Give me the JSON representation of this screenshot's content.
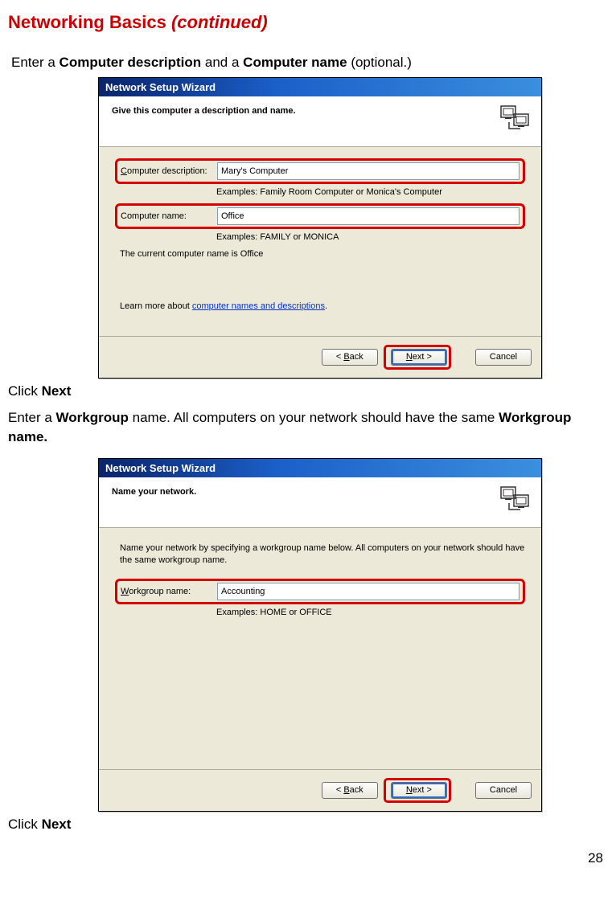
{
  "page": {
    "title_main": "Networking Basics ",
    "title_cont": "(continued)",
    "page_number": "28"
  },
  "instr": {
    "i1_pre": "Enter a ",
    "i1_b1": "Computer description",
    "i1_mid": " and a ",
    "i1_b2": "Computer name",
    "i1_post": " (optional.)",
    "click": "Click ",
    "next": "Next",
    "i2_pre": "Enter a ",
    "i2_b1": "Workgroup",
    "i2_mid": " name.  All computers on your network should have the same ",
    "i2_b2": "Workgroup name."
  },
  "wiz1": {
    "title": "Network Setup Wizard",
    "heading": "Give this computer a description and name.",
    "desc_label_u": "C",
    "desc_label_rest": "omputer description:",
    "desc_value": "Mary's Computer",
    "desc_example": "Examples: Family Room Computer or Monica's Computer",
    "name_label": "Computer name:",
    "name_value": "Office",
    "name_example": "Examples: FAMILY or MONICA",
    "current": "The current computer name is Office",
    "learn_pre": "Learn more about ",
    "learn_link": "computer names and descriptions",
    "learn_dot": ".",
    "back_pre": "< ",
    "back_u": "B",
    "back_rest": "ack",
    "next_u": "N",
    "next_rest": "ext >",
    "cancel": "Cancel"
  },
  "wiz2": {
    "title": "Network Setup Wizard",
    "heading": "Name your network.",
    "intro": "Name your network by specifying a workgroup name below. All computers on your network should have the same workgroup name.",
    "wg_label_u": "W",
    "wg_label_rest": "orkgroup name:",
    "wg_value": "Accounting",
    "wg_example": "Examples: HOME or OFFICE",
    "back_pre": "< ",
    "back_u": "B",
    "back_rest": "ack",
    "next_u": "N",
    "next_rest": "ext >",
    "cancel": "Cancel"
  }
}
